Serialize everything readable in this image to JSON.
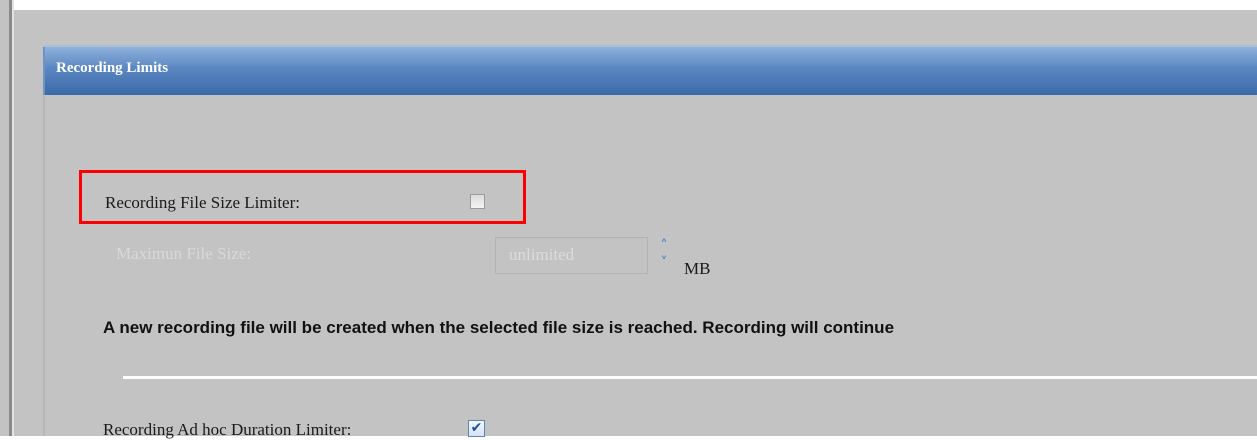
{
  "panel": {
    "title": "Recording Limits"
  },
  "file_size_limiter": {
    "label": "Recording File Size Limiter:",
    "checked": false
  },
  "max_file_size": {
    "label": "Maximun File Size:",
    "value": "unlimited",
    "unit": "MB",
    "spin_up_glyph": "˄",
    "spin_down_glyph": "˅"
  },
  "notice": {
    "text": "A new recording file will be created when the selected file size is reached. Recording will continue"
  },
  "adhoc_duration_limiter": {
    "label": "Recording Ad hoc Duration Limiter:",
    "checked": true,
    "check_glyph": "✔"
  },
  "colors": {
    "header_blue": "#3c6aa8",
    "highlight_red": "#ff0000",
    "background_gray": "#c3c3c3"
  }
}
